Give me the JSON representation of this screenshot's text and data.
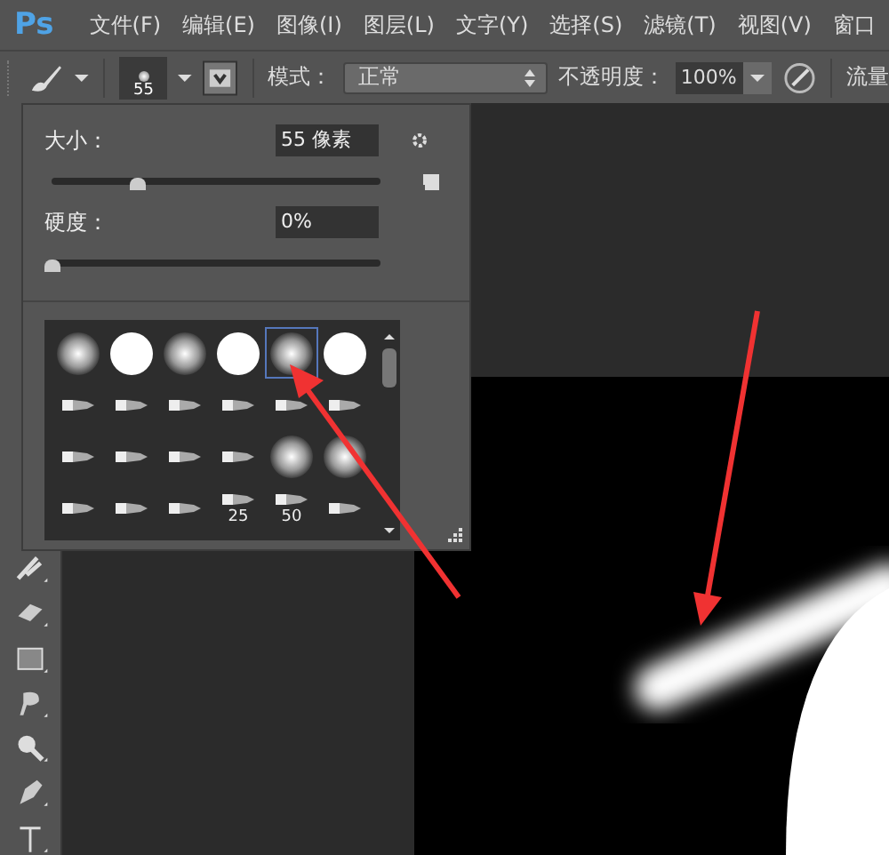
{
  "menu_bar": {
    "logo": "Ps",
    "items": [
      "文件(F)",
      "编辑(E)",
      "图像(I)",
      "图层(L)",
      "文字(Y)",
      "选择(S)",
      "滤镜(T)",
      "视图(V)",
      "窗口"
    ]
  },
  "options_bar": {
    "brush_size": "55",
    "mode_label": "模式：",
    "mode_value": "正常",
    "opacity_label": "不透明度：",
    "opacity_value": "100%",
    "flow_label": "流量"
  },
  "brush_panel": {
    "size": {
      "label": "大小：",
      "value": "55 像素",
      "level": 0.26
    },
    "hardness": {
      "label": "硬度：",
      "value": "0%",
      "level": 0
    },
    "presets": [
      {
        "kind": "soft",
        "selected": false
      },
      {
        "kind": "hard",
        "selected": false
      },
      {
        "kind": "soft",
        "selected": false
      },
      {
        "kind": "hard",
        "selected": false
      },
      {
        "kind": "soft",
        "selected": true
      },
      {
        "kind": "hard",
        "selected": false
      },
      {
        "kind": "tip",
        "selected": false
      },
      {
        "kind": "tip",
        "selected": false
      },
      {
        "kind": "tip",
        "selected": false
      },
      {
        "kind": "tip",
        "selected": false
      },
      {
        "kind": "tip",
        "selected": false
      },
      {
        "kind": "tip",
        "selected": false
      },
      {
        "kind": "tip",
        "selected": false
      },
      {
        "kind": "tip",
        "selected": false
      },
      {
        "kind": "tip",
        "selected": false
      },
      {
        "kind": "tip",
        "selected": false
      },
      {
        "kind": "soft",
        "selected": false
      },
      {
        "kind": "soft",
        "selected": false
      },
      {
        "kind": "tip",
        "selected": false
      },
      {
        "kind": "tip",
        "selected": false
      },
      {
        "kind": "tip",
        "selected": false
      },
      {
        "kind": "tip",
        "selected": false,
        "label": "25"
      },
      {
        "kind": "tip",
        "selected": false,
        "label": "50"
      },
      {
        "kind": "tip",
        "selected": false
      }
    ]
  }
}
